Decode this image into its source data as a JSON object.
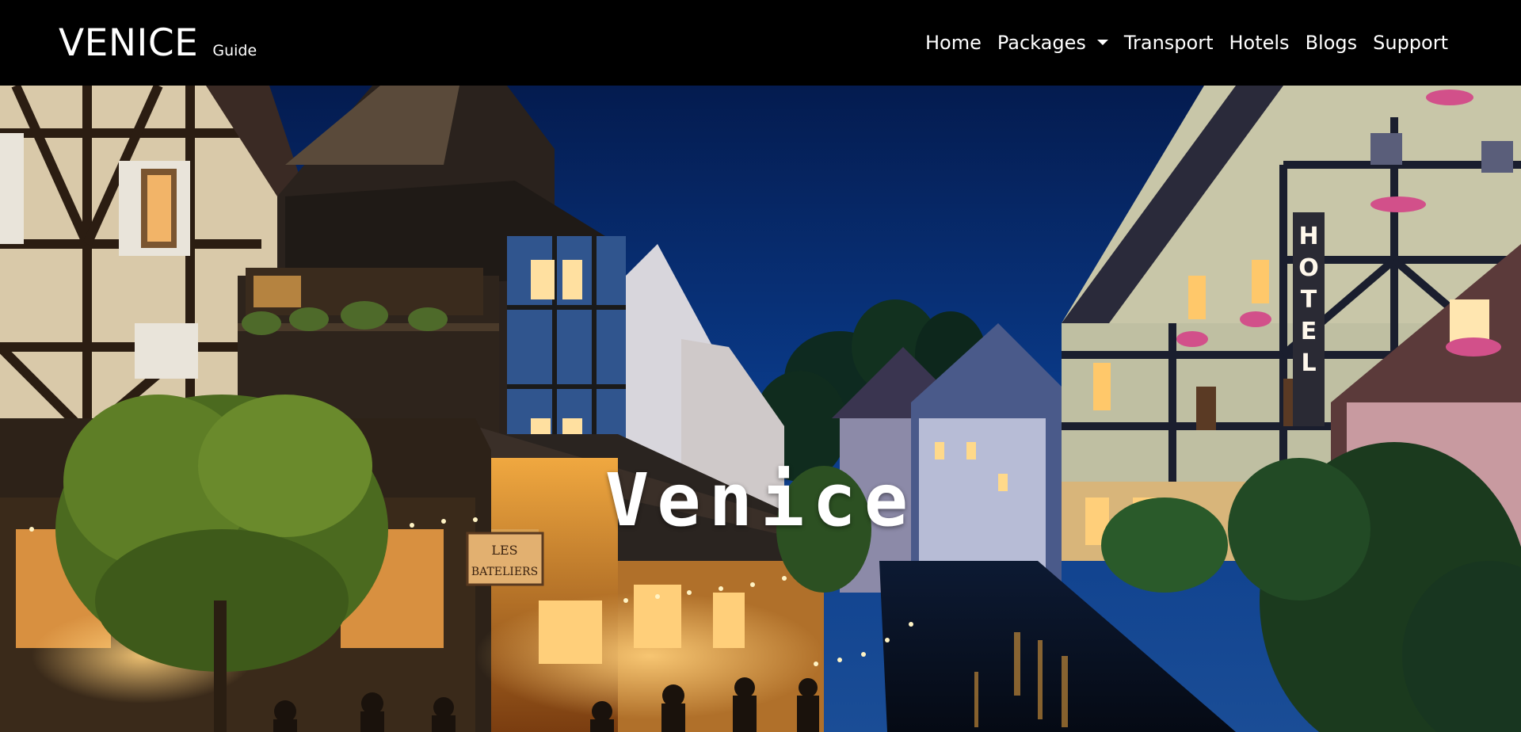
{
  "brand": {
    "name": "VENICE",
    "subtitle": "Guide"
  },
  "nav": {
    "items": [
      {
        "label": "Home",
        "has_dropdown": false
      },
      {
        "label": "Packages",
        "has_dropdown": true
      },
      {
        "label": "Transport",
        "has_dropdown": false
      },
      {
        "label": "Hotels",
        "has_dropdown": false
      },
      {
        "label": "Blogs",
        "has_dropdown": false
      },
      {
        "label": "Support",
        "has_dropdown": false
      }
    ]
  },
  "hero": {
    "title": "Venice",
    "image_description": "night canal street with half-timbered houses and lit restaurant terraces",
    "sign_hotel": "HOTEL",
    "sign_restaurant": [
      "LES",
      "BATELIERS"
    ]
  },
  "colors": {
    "navbar_bg": "#000000",
    "nav_text": "#ffffff",
    "sky": "#0a2a66"
  }
}
